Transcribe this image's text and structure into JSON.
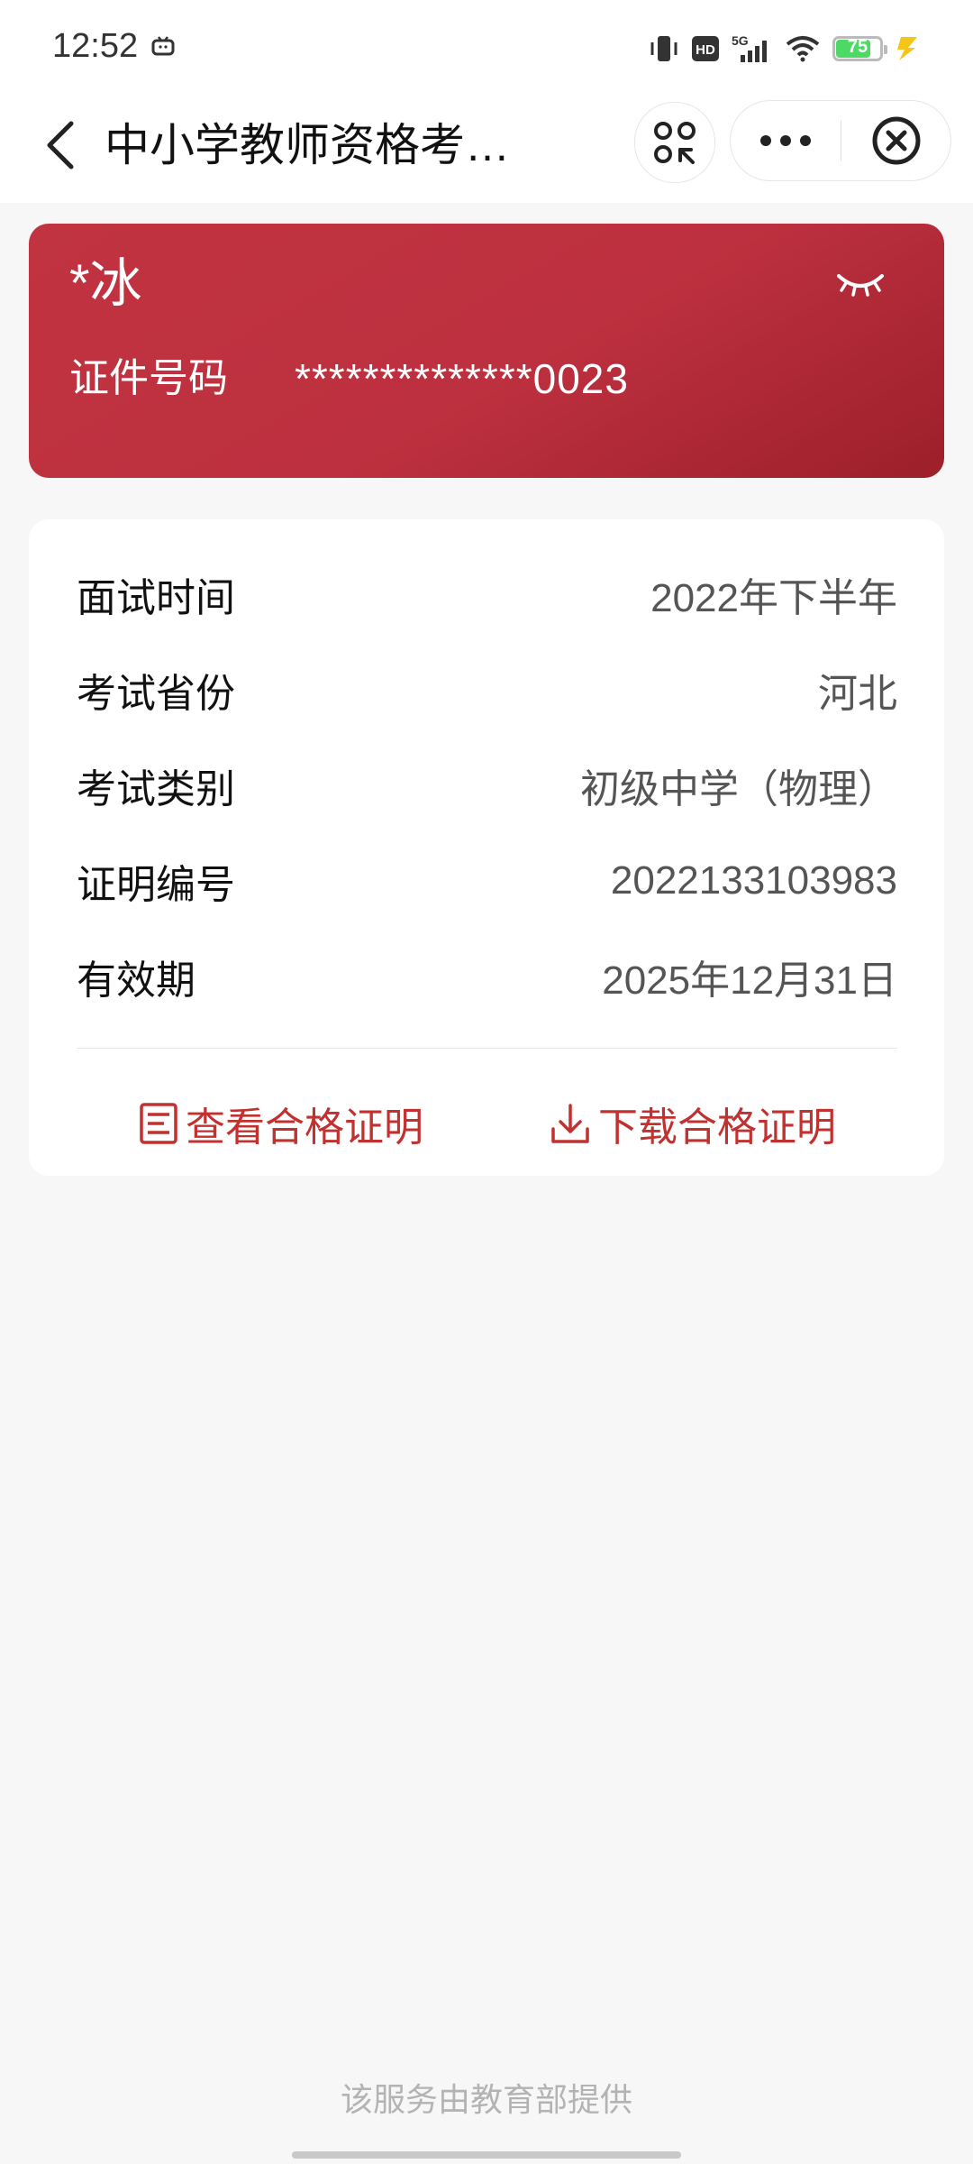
{
  "status_bar": {
    "time": "12:52",
    "battery_level": "75",
    "icons": [
      "tv-icon",
      "vibrate-icon",
      "hd-icon",
      "signal-5g-icon",
      "wifi-icon",
      "battery-icon",
      "charging-icon"
    ]
  },
  "nav": {
    "title": "中小学教师资格考…",
    "icons": [
      "back-arrow-icon",
      "scan-icon",
      "more-icon",
      "close-icon"
    ]
  },
  "id_card": {
    "name": "*冰",
    "id_label": "证件号码",
    "id_value": "**************0023",
    "background_color": "#bd303f",
    "icon": "eye-closed-icon"
  },
  "info": {
    "rows": [
      {
        "label": "面试时间",
        "value": "2022年下半年"
      },
      {
        "label": "考试省份",
        "value": "河北"
      },
      {
        "label": "考试类别",
        "value": "初级中学（物理）"
      },
      {
        "label": "证明编号",
        "value": "2022133103983"
      },
      {
        "label": "有效期",
        "value": "2025年12月31日"
      }
    ],
    "actions": {
      "view_label": "查看合格证明",
      "download_label": "下载合格证明",
      "accent_color": "#c0312f"
    }
  },
  "footer": {
    "note": "该服务由教育部提供"
  }
}
